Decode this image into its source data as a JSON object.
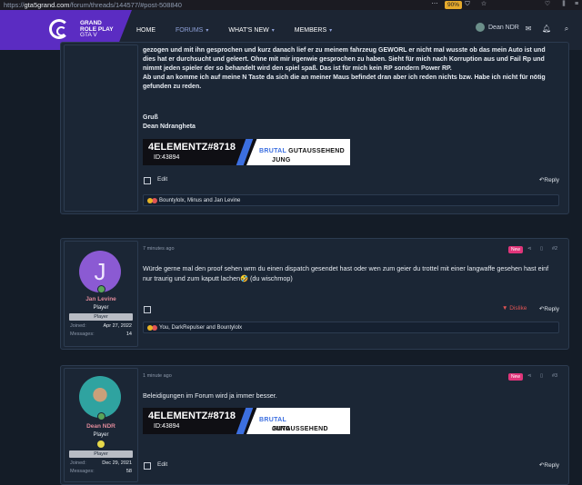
{
  "browser": {
    "url_prefix": "https://",
    "url_host": "gta5grand.com",
    "url_path": "/forum/threads/144577/#post-508840",
    "zoom": "90%"
  },
  "brand": {
    "line1": "GRAND",
    "line2": "ROLE PLAY",
    "line3": "GTA V"
  },
  "nav": {
    "home": "HOME",
    "forums": "FORUMS",
    "whats_new": "WHAT'S NEW",
    "members": "MEMBERS"
  },
  "account": {
    "name": "Dean NDR"
  },
  "post1": {
    "body": "gezogen und mit ihn gesprochen und kurz danach lief er zu meinem fahrzeug GEWORL er nicht mal wusste ob das mein Auto ist und dies hat er durchsucht und geleert. Ohne mit mir irgenwie gesprochen zu haben. Sieht für mich nach Korruption aus und Fail Rp und nimmt jeden spieler der so behandelt wird den spiel spaß. Das ist für mich kein RP sondern Power RP.\nAb und an komme ich auf meine N Taste da sich die an meiner Maus befindet dran aber ich reden nichts bzw. Habe ich nicht für nötig gefunden zu reden.",
    "greeting": "Gruß",
    "signed": "Dean Ndrangheta",
    "sig_left": "4ELEMENTZ#8718",
    "sig_id": "ID:43894",
    "sig_right_a": "JUNG ",
    "sig_right_b": "BRUTAL",
    "sig_right_c": " GUTAUSSEHEND",
    "edit": "Edit",
    "reply": "Reply",
    "reactions": "Bountylolx, Minus and Jan Levine"
  },
  "post2": {
    "time": "7 minutes ago",
    "badge": "New",
    "number": "#2",
    "author": "Jan Levine",
    "initial": "J",
    "title": "Player",
    "banner": "Player",
    "joined_label": "Joined:",
    "joined": "Apr 27, 2022",
    "messages_label": "Messages:",
    "messages": "14",
    "body": "Würde gerne mal den proof sehen wrm du einen dispatch gesendet hast oder wen zum geier du trottel mit einer langwaffe gesehen hast einf nur traurig und zum kaputt lachen🤣 (du wischmop)",
    "dislike": "Dislike",
    "reply": "Reply",
    "reactions": "You, DarkRepulser and Bountylolx"
  },
  "post3": {
    "time": "1 minute ago",
    "badge": "New",
    "number": "#3",
    "author": "Dean NDR",
    "title": "Player",
    "banner": "Player",
    "joined_label": "Joined:",
    "joined": "Dec 29, 2021",
    "messages_label": "Messages:",
    "messages": "58",
    "body": "Beleidigungen im Forum wird ja immer besser.",
    "sig_left": "4ELEMENTZ#8718",
    "sig_id": "ID:43894",
    "edit": "Edit",
    "reply": "Reply"
  }
}
